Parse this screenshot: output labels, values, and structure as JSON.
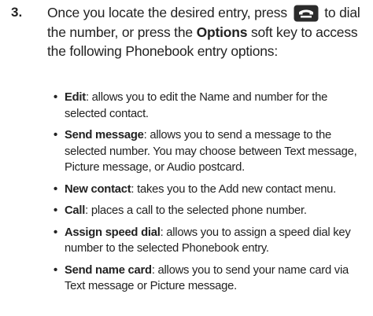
{
  "step": {
    "number": "3.",
    "text_before_icon": "Once you locate the desired entry, press",
    "icon": "send-key-icon",
    "text_after_icon_1": "to dial the number, or press the",
    "options_key": "Options",
    "text_after_icon_2": "soft key to access the following Phonebook entry options:"
  },
  "options": [
    {
      "term": "Edit",
      "desc": ": allows you to edit the Name and number for the selected contact."
    },
    {
      "term": "Send message",
      "desc": ": allows you to send a message to the selected number. You may choose between Text message, Picture message, or Audio postcard."
    },
    {
      "term": "New contact",
      "desc": ": takes you to the Add new contact menu."
    },
    {
      "term": "Call",
      "desc": ": places a call to the selected phone number."
    },
    {
      "term": "Assign speed dial",
      "desc": ": allows you to assign a speed dial key number to the selected Phonebook entry."
    },
    {
      "term": "Send name card",
      "desc": ": allows you to send your name card via Text message or Picture message."
    }
  ],
  "colors": {
    "text": "#222222",
    "icon": "#2b2b2b"
  }
}
